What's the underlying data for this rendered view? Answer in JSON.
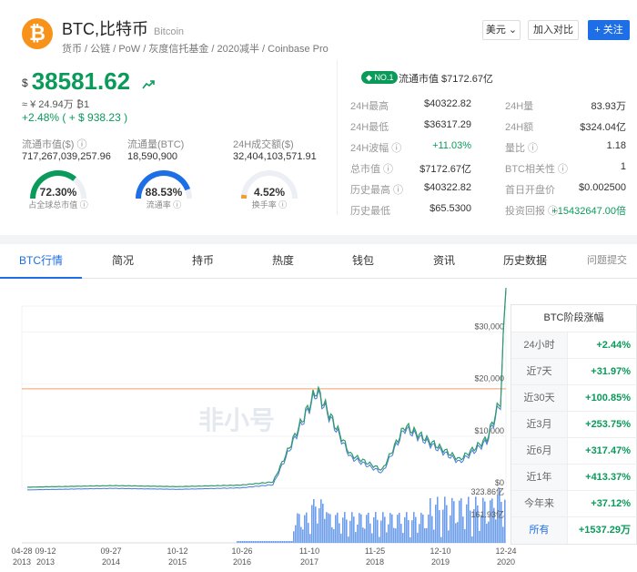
{
  "coin": {
    "symbol_name": "BTC,比特币",
    "en_name": "Bitcoin",
    "tags": "货币 / 公链 / PoW / 灰度信托基金 / 2020减半 / Coinbase Pro",
    "logo_glyph": "₿"
  },
  "header_buttons": {
    "currency": "美元",
    "compare": "加入对比",
    "follow": "+ 关注"
  },
  "price": {
    "currency_symbol": "$",
    "value": "38581.62",
    "cny": "≈ ¥ 24.94万  ₿1",
    "change": "+2.48%  ( + $ 938.23 )"
  },
  "stats": [
    {
      "label": "流通市值($) ⓘ",
      "value": "717,267,039,257.96"
    },
    {
      "label": "流通量(BTC)",
      "value": "18,590,900"
    },
    {
      "label": "24H成交额($)",
      "value": "32,404,103,571.91"
    }
  ],
  "gauges": [
    {
      "pct": "72.30%",
      "label": "占全球总市值 ⓘ",
      "fill": 0.723,
      "color": "#0a9a5a"
    },
    {
      "pct": "88.53%",
      "label": "流通率 ⓘ",
      "fill": 0.8853,
      "color": "#1e6fe5"
    },
    {
      "pct": "4.52%",
      "label": "换手率 ⓘ",
      "fill": 0.0452,
      "color": "#f39c34"
    }
  ],
  "market_cap": {
    "badge": "NO.1",
    "label": "流通市值  $7172.67亿"
  },
  "left_rows": [
    {
      "label": "24H最高",
      "value": "$40322.82"
    },
    {
      "label": "24H最低",
      "value": "$36317.29"
    },
    {
      "label": "24H波幅 ⓘ",
      "value": "+11.03%"
    },
    {
      "label": "总市值 ⓘ",
      "value": "$7172.67亿"
    },
    {
      "label": "历史最高 ⓘ",
      "value": "$40322.82"
    },
    {
      "label": "历史最低",
      "value": "$65.5300"
    }
  ],
  "right_rows": [
    {
      "label": "24H量",
      "value": "83.93万"
    },
    {
      "label": "24H额",
      "value": "$324.04亿"
    },
    {
      "label": "量比 ⓘ",
      "value": "1.18"
    },
    {
      "label": "BTC相关性 ⓘ",
      "value": "1"
    },
    {
      "label": "首日开盘价",
      "value": "$0.002500"
    },
    {
      "label": "投资回报 ⓘ",
      "value": "+15432647.00倍"
    }
  ],
  "tabs": [
    "BTC行情",
    "简况",
    "持币",
    "热度",
    "钱包",
    "资讯",
    "历史数据",
    "问题提交"
  ],
  "chart": {
    "watermark": "非小号",
    "y_labels": [
      "$30,000",
      "$20,000",
      "$10,000",
      "$0"
    ],
    "vol_labels": [
      "323.86亿",
      "161.93亿"
    ],
    "x_labels": [
      {
        "d": "04-28",
        "y": "2013"
      },
      {
        "d": "09-12",
        "y": "2013"
      },
      {
        "d": "09-27",
        "y": "2014"
      },
      {
        "d": "10-12",
        "y": "2015"
      },
      {
        "d": "10-26",
        "y": "2016"
      },
      {
        "d": "11-10",
        "y": "2017"
      },
      {
        "d": "11-25",
        "y": "2018"
      },
      {
        "d": "12-10",
        "y": "2019"
      },
      {
        "d": "12-24",
        "y": "2020"
      }
    ]
  },
  "chart_data": {
    "type": "line",
    "ylim": [
      0,
      35000
    ],
    "series": [],
    "x": [
      "2013",
      "2014",
      "2015",
      "2016",
      "2017-03",
      "2017-12",
      "2018-06",
      "2019-01",
      "2019-06",
      "2020-03",
      "2020-07",
      "2020-11",
      "2021-01"
    ],
    "values": [
      200,
      500,
      300,
      600,
      1200,
      19000,
      6500,
      3500,
      12000,
      5500,
      9500,
      17000,
      38500
    ]
  },
  "perf": {
    "title": "BTC阶段涨幅",
    "rows": [
      {
        "n": "24小时",
        "v": "+2.44%"
      },
      {
        "n": "近7天",
        "v": "+31.97%"
      },
      {
        "n": "近30天",
        "v": "+100.85%"
      },
      {
        "n": "近3月",
        "v": "+253.75%"
      },
      {
        "n": "近6月",
        "v": "+317.47%"
      },
      {
        "n": "近1年",
        "v": "+413.37%"
      },
      {
        "n": "今年来",
        "v": "+37.12%"
      },
      {
        "n": "所有",
        "v": "+1537.29万"
      }
    ]
  }
}
